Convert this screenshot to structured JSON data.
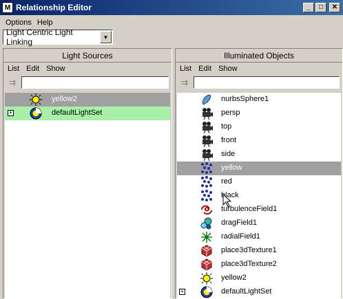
{
  "window": {
    "title": "Relationship Editor"
  },
  "menubar": {
    "options": "Options",
    "help": "Help"
  },
  "mode_dropdown": {
    "value": "Light Centric Light Linking"
  },
  "left_panel": {
    "title": "Light Sources",
    "menu": {
      "list": "List",
      "edit": "Edit",
      "show": "Show"
    },
    "items": [
      {
        "label": "yellow2",
        "icon": "point-light-icon",
        "state": "selected"
      },
      {
        "label": "defaultLightSet",
        "icon": "light-set-icon",
        "state": "highlighted",
        "expandable": true
      }
    ]
  },
  "right_panel": {
    "title": "Illuminated Objects",
    "menu": {
      "list": "List",
      "edit": "Edit",
      "show": "Show"
    },
    "items": [
      {
        "label": "nurbsSphere1",
        "icon": "nurbs-sphere-icon"
      },
      {
        "label": "persp",
        "icon": "camera-icon"
      },
      {
        "label": "top",
        "icon": "camera-icon"
      },
      {
        "label": "front",
        "icon": "camera-icon"
      },
      {
        "label": "side",
        "icon": "camera-icon"
      },
      {
        "label": "yellow",
        "icon": "particle-icon",
        "state": "selected"
      },
      {
        "label": "red",
        "icon": "particle-icon"
      },
      {
        "label": "black",
        "icon": "particle-icon"
      },
      {
        "label": "turbulenceField1",
        "icon": "turbulence-field-icon"
      },
      {
        "label": "dragField1",
        "icon": "drag-field-icon"
      },
      {
        "label": "radialField1",
        "icon": "radial-field-icon"
      },
      {
        "label": "place3dTexture1",
        "icon": "place3d-texture-icon"
      },
      {
        "label": "place3dTexture2",
        "icon": "place3d-texture-icon"
      },
      {
        "label": "yellow2",
        "icon": "point-light-icon"
      },
      {
        "label": "defaultLightSet",
        "icon": "light-set-icon",
        "expandable": true
      }
    ]
  },
  "colors": {
    "selected_row": "#a0a0a0",
    "highlighted_row": "#a8f0a8",
    "title_bar": "#0a246a"
  }
}
